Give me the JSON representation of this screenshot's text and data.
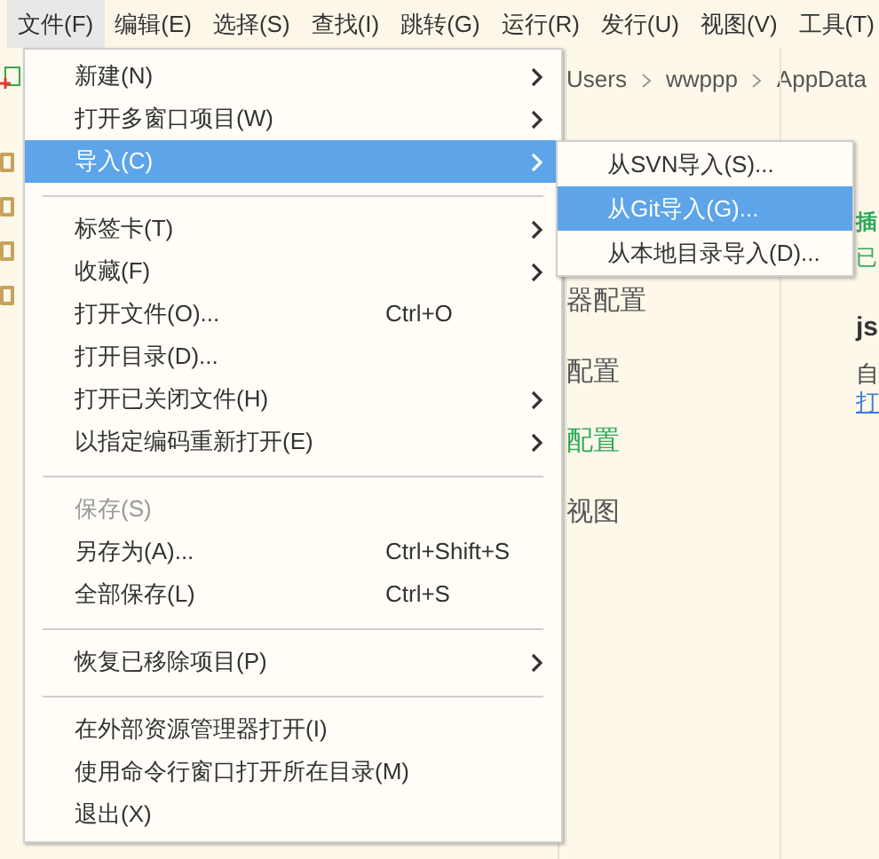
{
  "menubar": [
    {
      "label": "文件(F)",
      "selected": true
    },
    {
      "label": "编辑(E)",
      "selected": false
    },
    {
      "label": "选择(S)",
      "selected": false
    },
    {
      "label": "查找(I)",
      "selected": false
    },
    {
      "label": "跳转(G)",
      "selected": false
    },
    {
      "label": "运行(R)",
      "selected": false
    },
    {
      "label": "发行(U)",
      "selected": false
    },
    {
      "label": "视图(V)",
      "selected": false
    },
    {
      "label": "工具(T)",
      "selected": false
    }
  ],
  "breadcrumb": [
    "Users",
    "wwppp",
    "AppData"
  ],
  "background": {
    "settings_items": [
      {
        "text": "器配置",
        "accent": false
      },
      {
        "text": "配置",
        "accent": false
      },
      {
        "text": "配置",
        "accent": true
      },
      {
        "text": "视图",
        "accent": false
      }
    ],
    "side_texts": [
      {
        "kind": "heading",
        "text": "插"
      },
      {
        "kind": "note",
        "text": "已"
      },
      {
        "kind": "title",
        "text": "js"
      },
      {
        "kind": "plain",
        "text": "自"
      },
      {
        "kind": "link",
        "text": "打"
      }
    ]
  },
  "file_menu": [
    {
      "kind": "item",
      "label": "新建(N)",
      "submenu": true,
      "selected": false,
      "disabled": false
    },
    {
      "kind": "item",
      "label": "打开多窗口项目(W)",
      "submenu": true,
      "selected": false,
      "disabled": false
    },
    {
      "kind": "item",
      "label": "导入(C)",
      "submenu": true,
      "selected": true,
      "disabled": false
    },
    {
      "kind": "separator"
    },
    {
      "kind": "item",
      "label": "标签卡(T)",
      "submenu": true,
      "selected": false,
      "disabled": false
    },
    {
      "kind": "item",
      "label": "收藏(F)",
      "submenu": true,
      "selected": false,
      "disabled": false
    },
    {
      "kind": "item",
      "label": "打开文件(O)...",
      "shortcut": "Ctrl+O",
      "submenu": false,
      "selected": false,
      "disabled": false
    },
    {
      "kind": "item",
      "label": "打开目录(D)...",
      "submenu": false,
      "selected": false,
      "disabled": false
    },
    {
      "kind": "item",
      "label": "打开已关闭文件(H)",
      "submenu": true,
      "selected": false,
      "disabled": false
    },
    {
      "kind": "item",
      "label": "以指定编码重新打开(E)",
      "submenu": true,
      "selected": false,
      "disabled": false
    },
    {
      "kind": "separator"
    },
    {
      "kind": "item",
      "label": "保存(S)",
      "submenu": false,
      "selected": false,
      "disabled": true
    },
    {
      "kind": "item",
      "label": "另存为(A)...",
      "shortcut": "Ctrl+Shift+S",
      "submenu": false,
      "selected": false,
      "disabled": false
    },
    {
      "kind": "item",
      "label": "全部保存(L)",
      "shortcut": "Ctrl+S",
      "submenu": false,
      "selected": false,
      "disabled": false
    },
    {
      "kind": "separator"
    },
    {
      "kind": "item",
      "label": "恢复已移除项目(P)",
      "submenu": true,
      "selected": false,
      "disabled": false
    },
    {
      "kind": "separator"
    },
    {
      "kind": "item",
      "label": "在外部资源管理器打开(I)",
      "submenu": false,
      "selected": false,
      "disabled": false
    },
    {
      "kind": "item",
      "label": "使用命令行窗口打开所在目录(M)",
      "submenu": false,
      "selected": false,
      "disabled": false
    },
    {
      "kind": "item",
      "label": "退出(X)",
      "submenu": false,
      "selected": false,
      "disabled": false
    }
  ],
  "import_submenu": [
    {
      "label": "从SVN导入(S)...",
      "selected": false
    },
    {
      "label": "从Git导入(G)...",
      "selected": true
    },
    {
      "label": "从本地目录导入(D)...",
      "selected": false
    }
  ]
}
